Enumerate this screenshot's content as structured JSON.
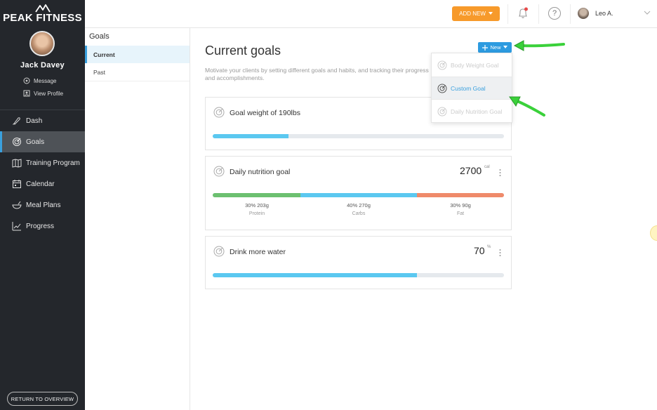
{
  "brand": {
    "name": "PEAK FITNESS"
  },
  "client": {
    "name": "Jack Davey",
    "message_label": "Message",
    "profile_label": "View Profile"
  },
  "nav": {
    "items": [
      {
        "label": "Dash",
        "icon": "rocket-icon"
      },
      {
        "label": "Goals",
        "icon": "target-icon",
        "active": true
      },
      {
        "label": "Training Program",
        "icon": "book-icon"
      },
      {
        "label": "Calendar",
        "icon": "calendar-icon"
      },
      {
        "label": "Meal Plans",
        "icon": "bowl-icon"
      },
      {
        "label": "Progress",
        "icon": "chart-icon"
      }
    ],
    "return_label": "RETURN TO OVERVIEW"
  },
  "topbar": {
    "add_new_label": "ADD NEW",
    "user_name": "Leo A."
  },
  "subnav": {
    "title": "Goals",
    "items": [
      {
        "label": "Current",
        "active": true
      },
      {
        "label": "Past"
      }
    ]
  },
  "main": {
    "title": "Current goals",
    "description": "Motivate your clients by setting different goals and habits, and tracking their progress and accomplishments.",
    "new_button_label": "New"
  },
  "dropdown": {
    "items": [
      {
        "label": "Body Weight Goal",
        "state": "disabled"
      },
      {
        "label": "Custom Goal",
        "state": "selected"
      },
      {
        "label": "Daily Nutrition Goal",
        "state": "disabled"
      }
    ]
  },
  "goals": [
    {
      "title": "Goal weight of 190lbs",
      "progress": 0.26
    },
    {
      "title": "Daily nutrition goal",
      "value": "2700",
      "unit": "cal",
      "macros": [
        {
          "text": "30% 203g",
          "name": "Protein",
          "share": 0.3,
          "color": "#6cc070"
        },
        {
          "text": "40% 270g",
          "name": "Carbs",
          "share": 0.4,
          "color": "#5bc8f0"
        },
        {
          "text": "30% 90g",
          "name": "Fat",
          "share": 0.3,
          "color": "#ef8a6a"
        }
      ]
    },
    {
      "title": "Drink more water",
      "value": "70",
      "unit": "%",
      "progress": 0.7
    }
  ],
  "colors": {
    "accent": "#3aa0de",
    "sidebar_bg": "#24272c",
    "add_new": "#f79a2b",
    "progress_fill": "#5bc8f0",
    "annotation_arrow": "#3ad13a"
  }
}
